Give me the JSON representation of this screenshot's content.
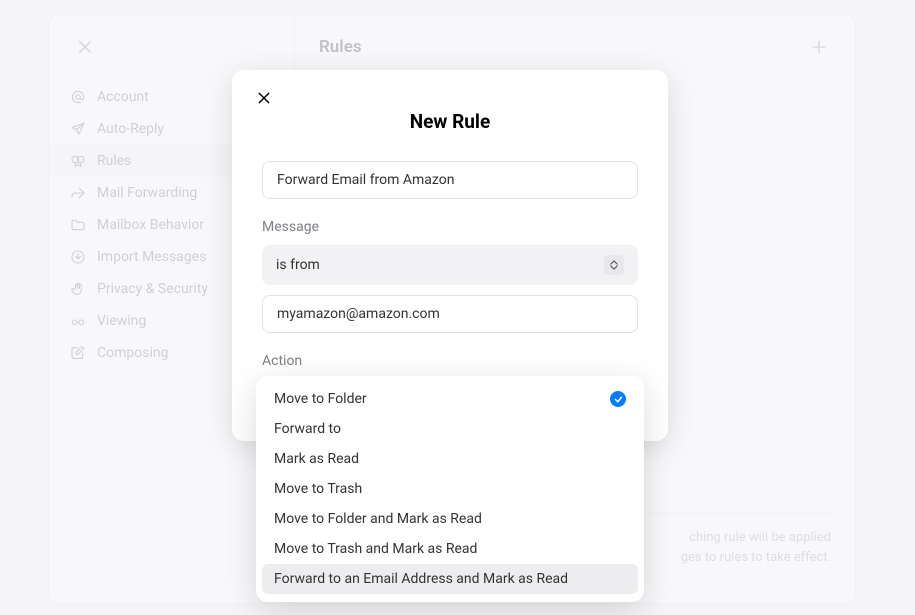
{
  "sidebar": {
    "items": [
      {
        "label": "Account",
        "icon": "at"
      },
      {
        "label": "Auto-Reply",
        "icon": "paperplane"
      },
      {
        "label": "Rules",
        "icon": "filter"
      },
      {
        "label": "Mail Forwarding",
        "icon": "forward"
      },
      {
        "label": "Mailbox Behavior",
        "icon": "folder"
      },
      {
        "label": "Import Messages",
        "icon": "download"
      },
      {
        "label": "Privacy & Security",
        "icon": "hand"
      },
      {
        "label": "Viewing",
        "icon": "glasses"
      },
      {
        "label": "Composing",
        "icon": "compose"
      }
    ],
    "active_index": 2
  },
  "content": {
    "title": "Rules",
    "footer_line1": "ching rule will be applied",
    "footer_line2": "ges to rules to take effect."
  },
  "modal": {
    "title": "New Rule",
    "rule_name": "Forward Email from Amazon",
    "message_label": "Message",
    "message_condition": "is from",
    "message_value": "myamazon@amazon.com",
    "action_label": "Action",
    "action_options": [
      "Move to Folder",
      "Forward to",
      "Mark as Read",
      "Move to Trash",
      "Move to Folder and Mark as Read",
      "Move to Trash and Mark as Read",
      "Forward to an Email Address and Mark as Read"
    ],
    "action_selected_index": 0,
    "action_highlight_index": 6
  }
}
